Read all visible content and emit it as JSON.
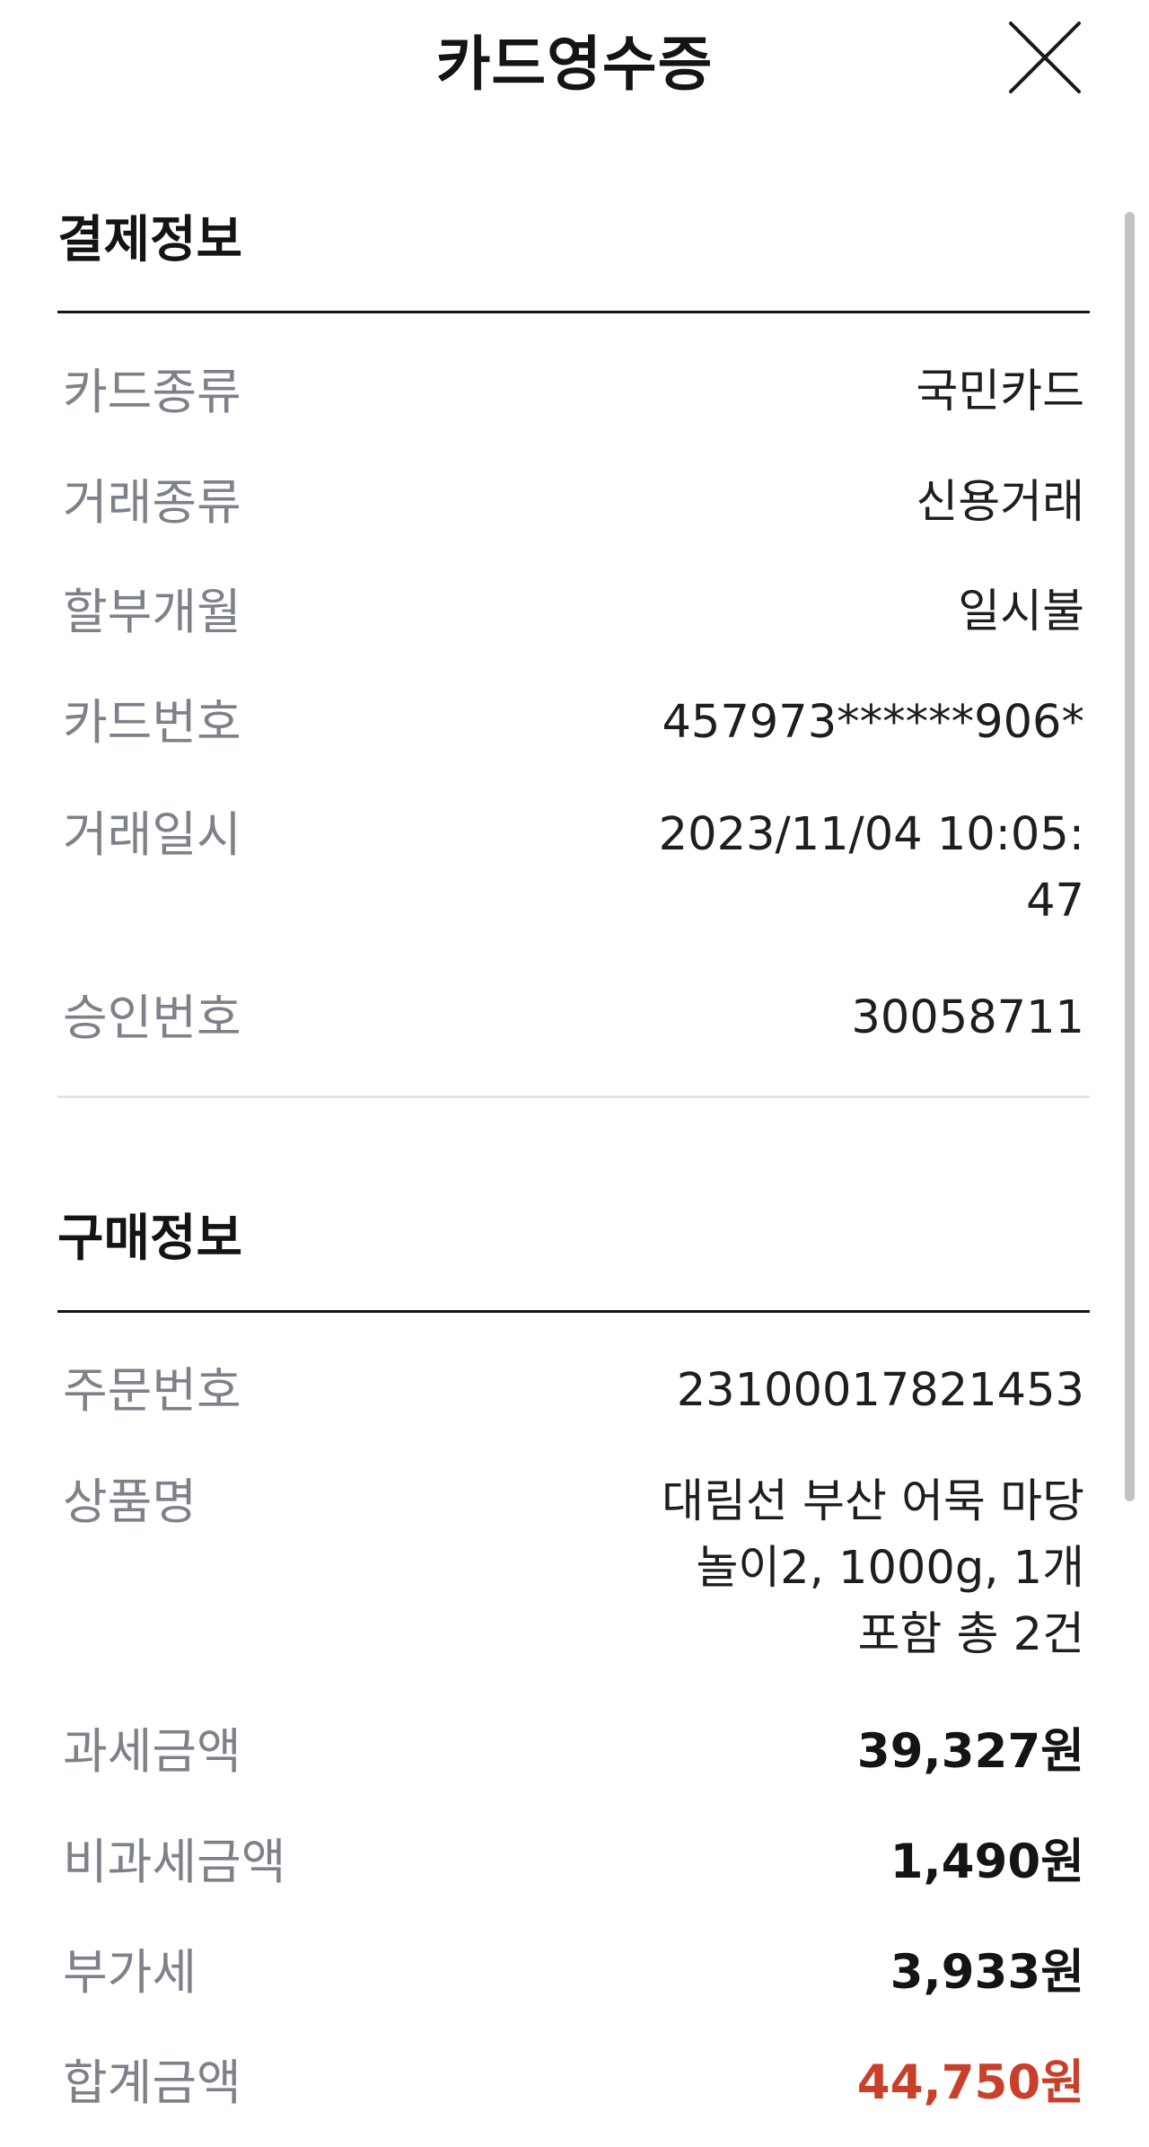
{
  "header": {
    "title": "카드영수증"
  },
  "payment_info": {
    "title": "결제정보",
    "rows": [
      {
        "label": "카드종류",
        "value": "국민카드"
      },
      {
        "label": "거래종류",
        "value": "신용거래"
      },
      {
        "label": "할부개월",
        "value": "일시불"
      },
      {
        "label": "카드번호",
        "value": "457973******906*"
      },
      {
        "label": "거래일시",
        "value": "2023/11/04 10:05:\n47"
      },
      {
        "label": "승인번호",
        "value": "30058711"
      }
    ]
  },
  "purchase_info": {
    "title": "구매정보",
    "rows": [
      {
        "label": "주문번호",
        "value": "23100017821453"
      },
      {
        "label": "상품명",
        "value": "대림선 부산 어묵 마당\n놀이2, 1000g, 1개\n포함 총 2건"
      },
      {
        "label": "과세금액",
        "value": "39,327원"
      },
      {
        "label": "비과세금액",
        "value": "1,490원"
      },
      {
        "label": "부가세",
        "value": "3,933원"
      },
      {
        "label": "합계금액",
        "value": "44,750원"
      }
    ]
  },
  "colors": {
    "total_amount": "#c8402a",
    "label_gray": "#7e8189"
  }
}
